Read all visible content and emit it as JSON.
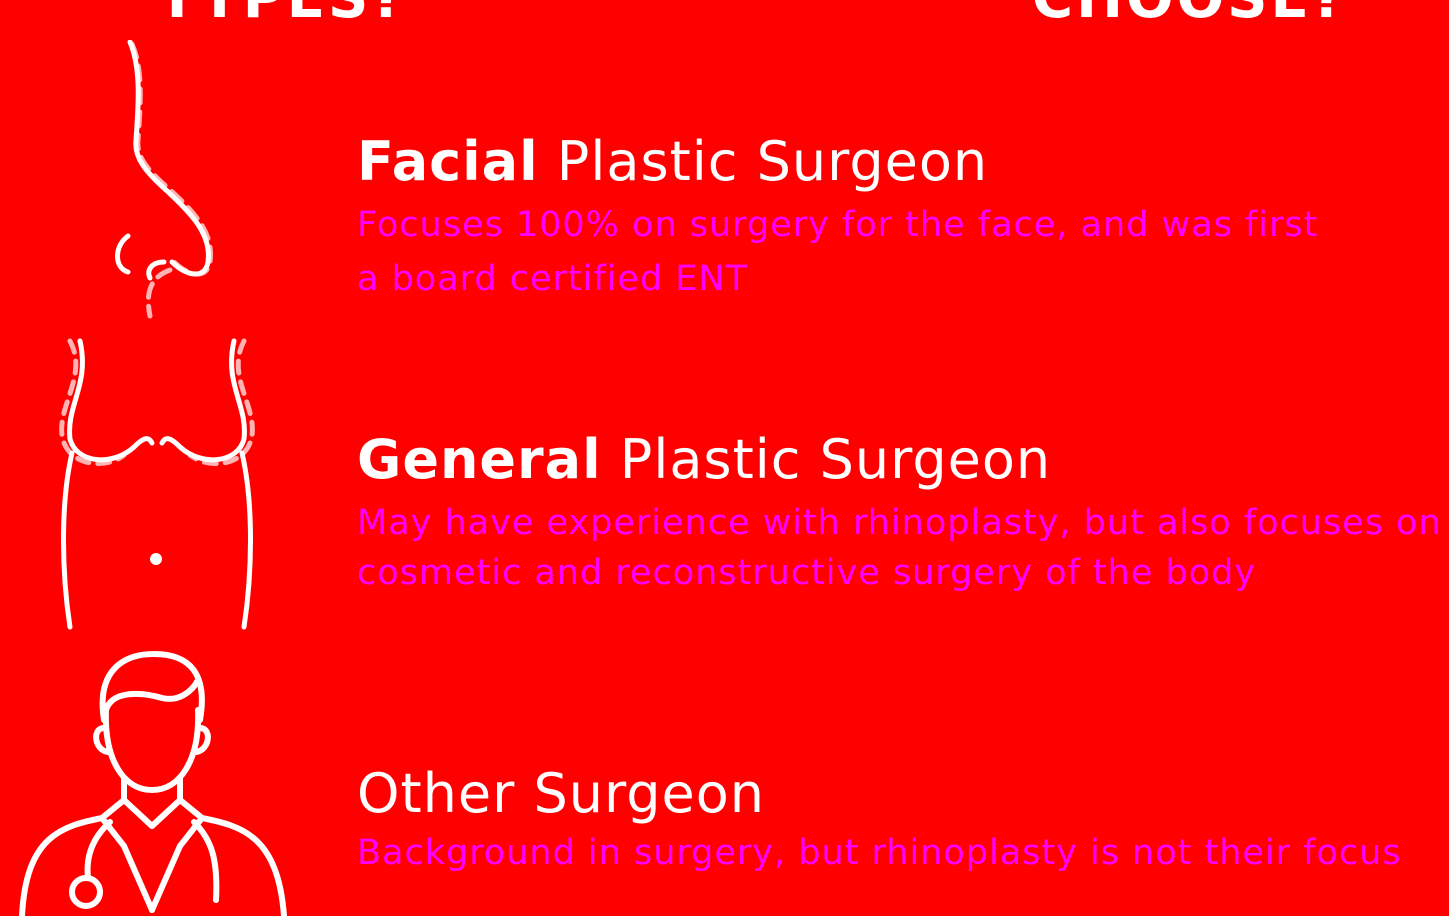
{
  "header": {
    "left_fragment": "TYPES?",
    "right_fragment": "CHOOSE?"
  },
  "colors": {
    "background": "#ff0000",
    "heading": "#ffffff",
    "description": "#ff00ff",
    "dashed_guide": "#ffb3b3"
  },
  "items": [
    {
      "icon": "nose-outline-icon",
      "title_strong": "Facial",
      "title_rest": " Plastic Surgeon",
      "description_lines": [
        "Focuses 100% on surgery for the face, and was first",
        "a board certified ENT"
      ]
    },
    {
      "icon": "torso-outline-icon",
      "title_strong": "General",
      "title_rest": " Plastic Surgeon",
      "description_lines": [
        "May have experience with rhinoplasty, but also focuses on",
        "cosmetic and reconstructive surgery of the body"
      ]
    },
    {
      "icon": "doctor-stethoscope-icon",
      "title_strong": "Other Surgeon",
      "title_rest": "",
      "description_lines": [
        "Background in surgery, but rhinoplasty is not their focus"
      ]
    }
  ]
}
